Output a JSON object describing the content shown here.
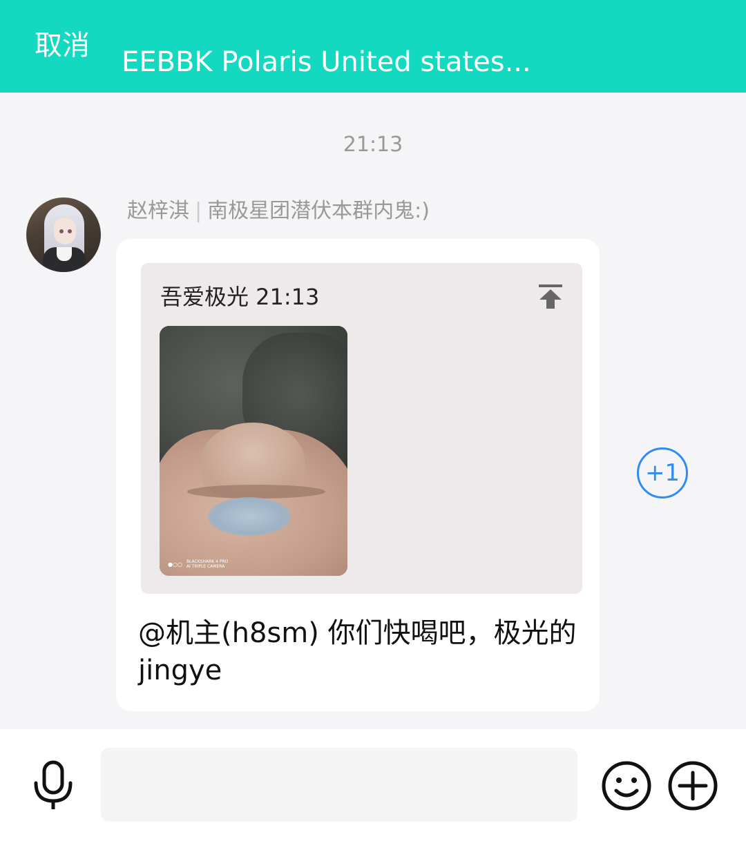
{
  "header": {
    "cancel_label": "取消",
    "title": "EEBBK Polaris United states...",
    "background_color": "#12d9bf"
  },
  "chat": {
    "time_label": "21:13",
    "message": {
      "sender_name": "赵梓淇",
      "sender_title": "南极星团潜伏本群内鬼:)",
      "quote": {
        "author_time": "吾爱极光 21:13",
        "image_watermark_line1": "BLACKSHARK 4 PRO",
        "image_watermark_line2": "AI TRIPLE CAMERA",
        "pin_icon": "pin-to-top-icon"
      },
      "text": "@机主(h8sm) 你们快喝吧，极光的jingye"
    },
    "plus_one_label": "+1",
    "accent_color": "#2f8cf5"
  },
  "composer": {
    "input_value": "",
    "input_placeholder": "",
    "mic_icon": "microphone-icon",
    "emoji_icon": "smile-emoji-icon",
    "plus_icon": "add-circle-icon"
  }
}
